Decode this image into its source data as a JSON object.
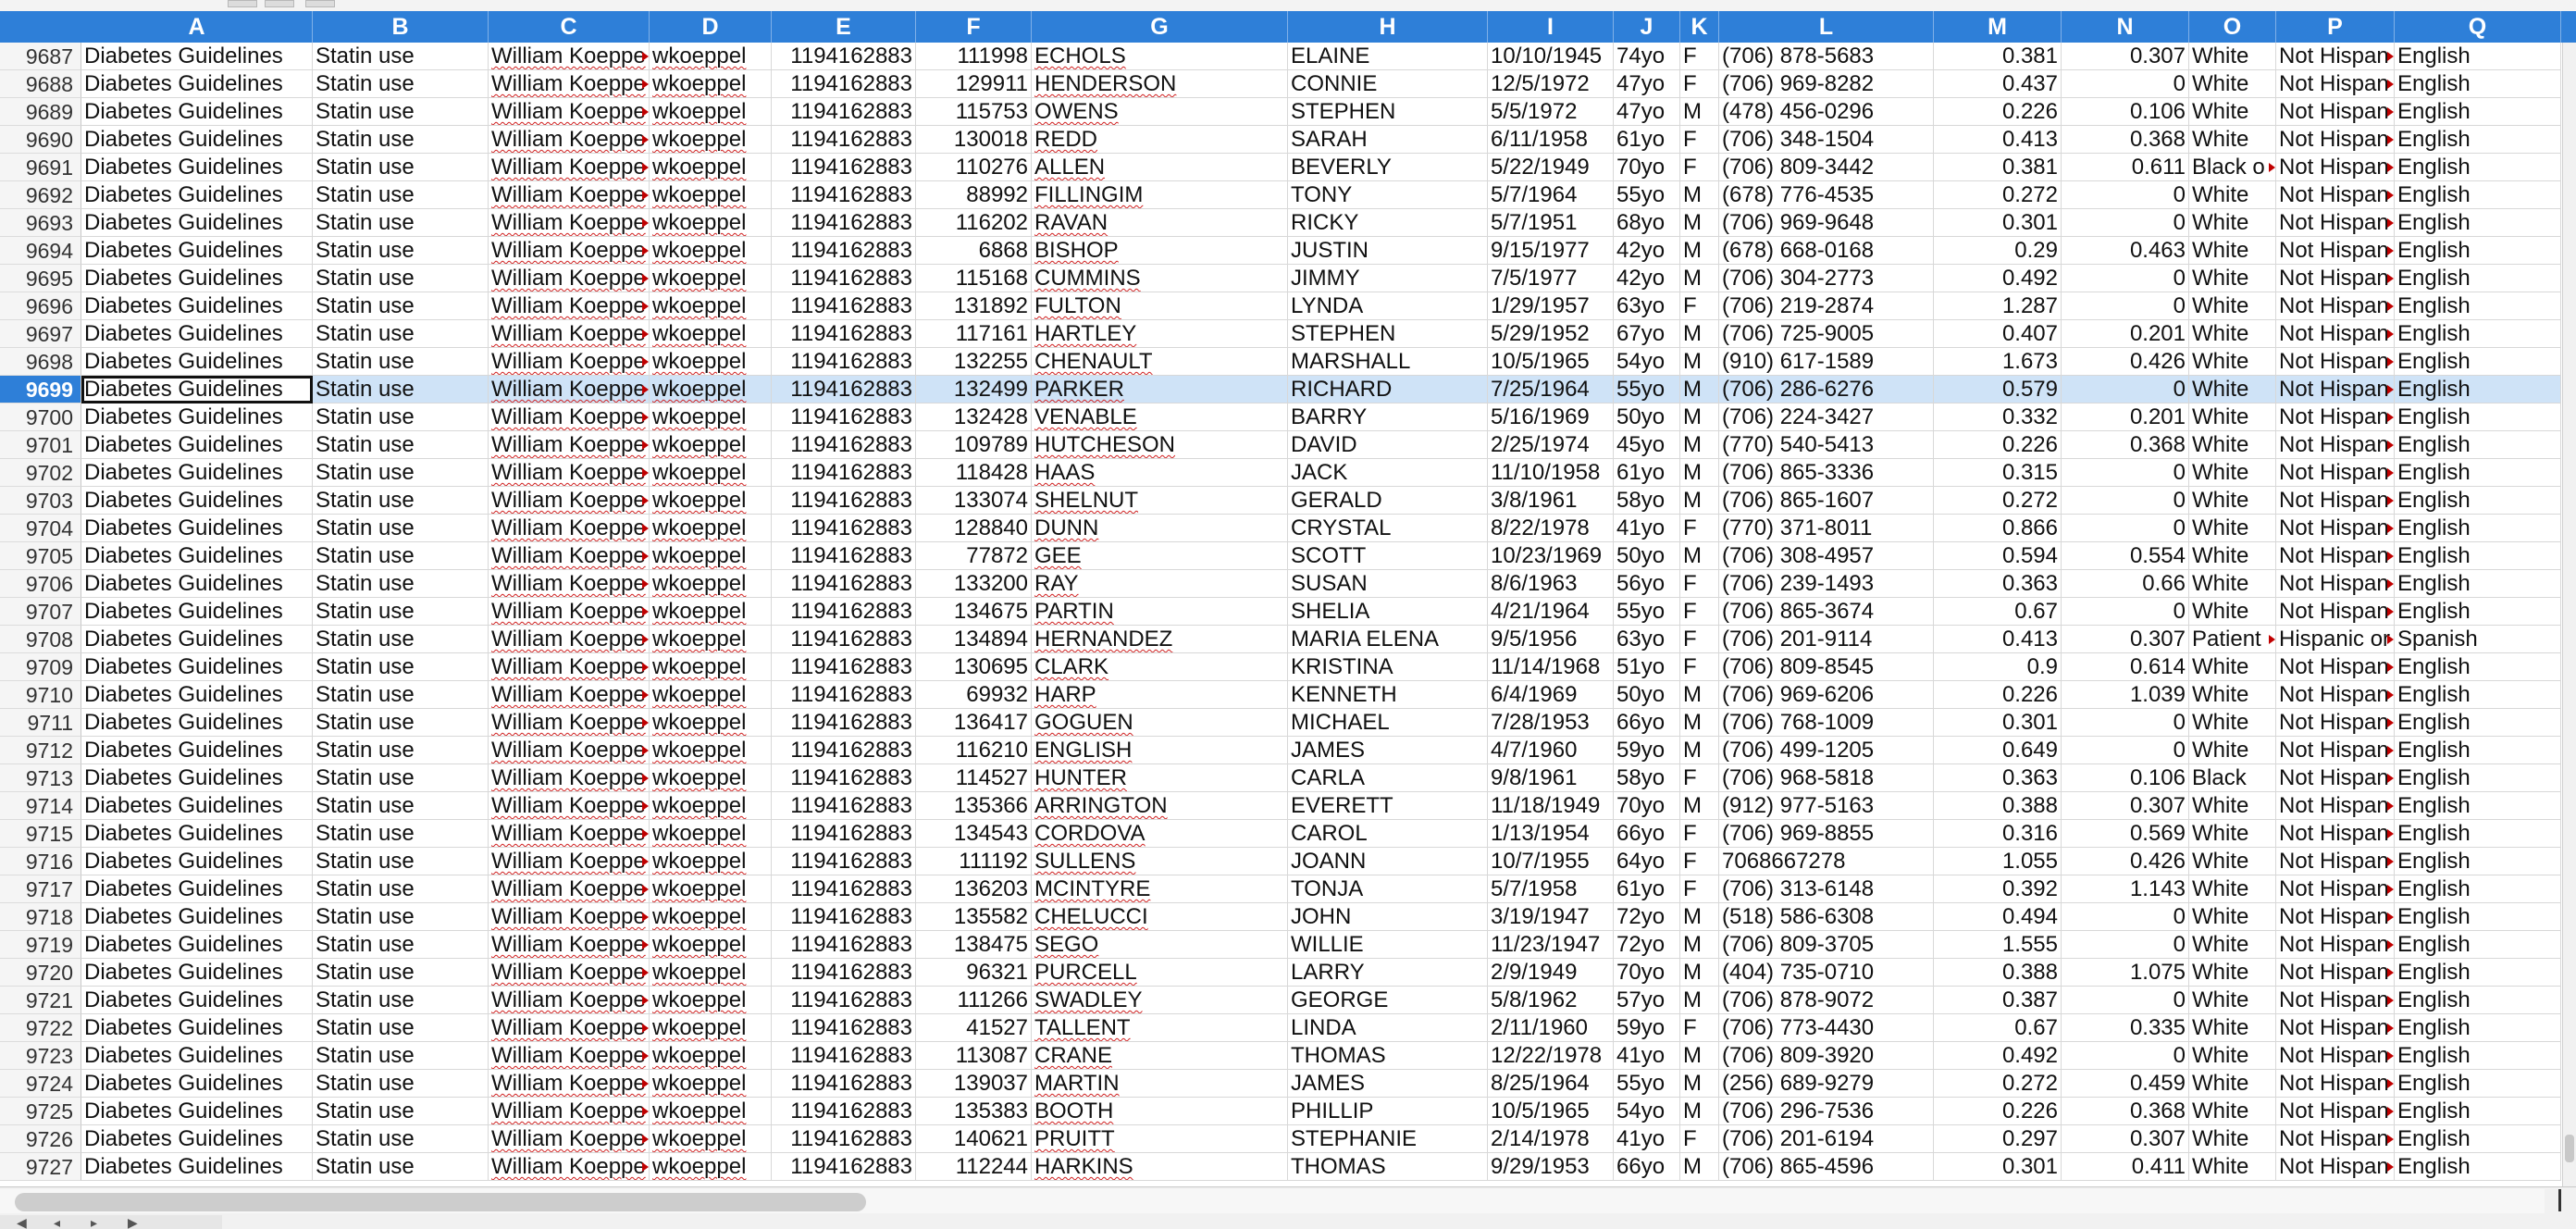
{
  "columns": [
    "A",
    "B",
    "C",
    "D",
    "E",
    "F",
    "G",
    "H",
    "I",
    "J",
    "K",
    "L",
    "M",
    "N",
    "O",
    "P",
    "Q"
  ],
  "selected_row": "9699",
  "rows": [
    [
      "9687",
      "Diabetes Guidelines",
      "Statin use",
      "William Koeppe",
      "wkoeppel",
      "1194162883",
      "111998",
      "ECHOLS",
      "ELAINE",
      "10/10/1945",
      "74yo",
      "F",
      "(706) 878-5683",
      "0.381",
      "0.307",
      "White",
      "Not Hispan",
      "English"
    ],
    [
      "9688",
      "Diabetes Guidelines",
      "Statin use",
      "William Koeppe",
      "wkoeppel",
      "1194162883",
      "129911",
      "HENDERSON",
      "CONNIE",
      "12/5/1972",
      "47yo",
      "F",
      "(706) 969-8282",
      "0.437",
      "0",
      "White",
      "Not Hispan",
      "English"
    ],
    [
      "9689",
      "Diabetes Guidelines",
      "Statin use",
      "William Koeppe",
      "wkoeppel",
      "1194162883",
      "115753",
      "OWENS",
      "STEPHEN",
      "5/5/1972",
      "47yo",
      "M",
      "(478) 456-0296",
      "0.226",
      "0.106",
      "White",
      "Not Hispan",
      "English"
    ],
    [
      "9690",
      "Diabetes Guidelines",
      "Statin use",
      "William Koeppe",
      "wkoeppel",
      "1194162883",
      "130018",
      "REDD",
      "SARAH",
      "6/11/1958",
      "61yo",
      "F",
      "(706) 348-1504",
      "0.413",
      "0.368",
      "White",
      "Not Hispan",
      "English"
    ],
    [
      "9691",
      "Diabetes Guidelines",
      "Statin use",
      "William Koeppe",
      "wkoeppel",
      "1194162883",
      "110276",
      "ALLEN",
      "BEVERLY",
      "5/22/1949",
      "70yo",
      "F",
      "(706) 809-3442",
      "0.381",
      "0.611",
      "Black o",
      "Not Hispan",
      "English"
    ],
    [
      "9692",
      "Diabetes Guidelines",
      "Statin use",
      "William Koeppe",
      "wkoeppel",
      "1194162883",
      "88992",
      "FILLINGIM",
      "TONY",
      "5/7/1964",
      "55yo",
      "M",
      "(678) 776-4535",
      "0.272",
      "0",
      "White",
      "Not Hispan",
      "English"
    ],
    [
      "9693",
      "Diabetes Guidelines",
      "Statin use",
      "William Koeppe",
      "wkoeppel",
      "1194162883",
      "116202",
      "RAVAN",
      "RICKY",
      "5/7/1951",
      "68yo",
      "M",
      "(706) 969-9648",
      "0.301",
      "0",
      "White",
      "Not Hispan",
      "English"
    ],
    [
      "9694",
      "Diabetes Guidelines",
      "Statin use",
      "William Koeppe",
      "wkoeppel",
      "1194162883",
      "6868",
      "BISHOP",
      "JUSTIN",
      "9/15/1977",
      "42yo",
      "M",
      "(678) 668-0168",
      "0.29",
      "0.463",
      "White",
      "Not Hispan",
      "English"
    ],
    [
      "9695",
      "Diabetes Guidelines",
      "Statin use",
      "William Koeppe",
      "wkoeppel",
      "1194162883",
      "115168",
      "CUMMINS",
      "JIMMY",
      "7/5/1977",
      "42yo",
      "M",
      "(706) 304-2773",
      "0.492",
      "0",
      "White",
      "Not Hispan",
      "English"
    ],
    [
      "9696",
      "Diabetes Guidelines",
      "Statin use",
      "William Koeppe",
      "wkoeppel",
      "1194162883",
      "131892",
      "FULTON",
      "LYNDA",
      "1/29/1957",
      "63yo",
      "F",
      "(706) 219-2874",
      "1.287",
      "0",
      "White",
      "Not Hispan",
      "English"
    ],
    [
      "9697",
      "Diabetes Guidelines",
      "Statin use",
      "William Koeppe",
      "wkoeppel",
      "1194162883",
      "117161",
      "HARTLEY",
      "STEPHEN",
      "5/29/1952",
      "67yo",
      "M",
      "(706) 725-9005",
      "0.407",
      "0.201",
      "White",
      "Not Hispan",
      "English"
    ],
    [
      "9698",
      "Diabetes Guidelines",
      "Statin use",
      "William Koeppe",
      "wkoeppel",
      "1194162883",
      "132255",
      "CHENAULT",
      "MARSHALL",
      "10/5/1965",
      "54yo",
      "M",
      "(910) 617-1589",
      "1.673",
      "0.426",
      "White",
      "Not Hispan",
      "English"
    ],
    [
      "9699",
      "Diabetes Guidelines",
      "Statin use",
      "William Koeppe",
      "wkoeppel",
      "1194162883",
      "132499",
      "PARKER",
      "RICHARD",
      "7/25/1964",
      "55yo",
      "M",
      "(706) 286-6276",
      "0.579",
      "0",
      "White",
      "Not Hispan",
      "English"
    ],
    [
      "9700",
      "Diabetes Guidelines",
      "Statin use",
      "William Koeppe",
      "wkoeppel",
      "1194162883",
      "132428",
      "VENABLE",
      "BARRY",
      "5/16/1969",
      "50yo",
      "M",
      "(706) 224-3427",
      "0.332",
      "0.201",
      "White",
      "Not Hispan",
      "English"
    ],
    [
      "9701",
      "Diabetes Guidelines",
      "Statin use",
      "William Koeppe",
      "wkoeppel",
      "1194162883",
      "109789",
      "HUTCHESON",
      "DAVID",
      "2/25/1974",
      "45yo",
      "M",
      "(770) 540-5413",
      "0.226",
      "0.368",
      "White",
      "Not Hispan",
      "English"
    ],
    [
      "9702",
      "Diabetes Guidelines",
      "Statin use",
      "William Koeppe",
      "wkoeppel",
      "1194162883",
      "118428",
      "HAAS",
      "JACK",
      "11/10/1958",
      "61yo",
      "M",
      "(706) 865-3336",
      "0.315",
      "0",
      "White",
      "Not Hispan",
      "English"
    ],
    [
      "9703",
      "Diabetes Guidelines",
      "Statin use",
      "William Koeppe",
      "wkoeppel",
      "1194162883",
      "133074",
      "SHELNUT",
      "GERALD",
      "3/8/1961",
      "58yo",
      "M",
      "(706) 865-1607",
      "0.272",
      "0",
      "White",
      "Not Hispan",
      "English"
    ],
    [
      "9704",
      "Diabetes Guidelines",
      "Statin use",
      "William Koeppe",
      "wkoeppel",
      "1194162883",
      "128840",
      "DUNN",
      "CRYSTAL",
      "8/22/1978",
      "41yo",
      "F",
      "(770) 371-8011",
      "0.866",
      "0",
      "White",
      "Not Hispan",
      "English"
    ],
    [
      "9705",
      "Diabetes Guidelines",
      "Statin use",
      "William Koeppe",
      "wkoeppel",
      "1194162883",
      "77872",
      "GEE",
      "SCOTT",
      "10/23/1969",
      "50yo",
      "M",
      "(706) 308-4957",
      "0.594",
      "0.554",
      "White",
      "Not Hispan",
      "English"
    ],
    [
      "9706",
      "Diabetes Guidelines",
      "Statin use",
      "William Koeppe",
      "wkoeppel",
      "1194162883",
      "133200",
      "RAY",
      "SUSAN",
      "8/6/1963",
      "56yo",
      "F",
      "(706) 239-1493",
      "0.363",
      "0.66",
      "White",
      "Not Hispan",
      "English"
    ],
    [
      "9707",
      "Diabetes Guidelines",
      "Statin use",
      "William Koeppe",
      "wkoeppel",
      "1194162883",
      "134675",
      "PARTIN",
      "SHELIA",
      "4/21/1964",
      "55yo",
      "F",
      "(706) 865-3674",
      "0.67",
      "0",
      "White",
      "Not Hispan",
      "English"
    ],
    [
      "9708",
      "Diabetes Guidelines",
      "Statin use",
      "William Koeppe",
      "wkoeppel",
      "1194162883",
      "134894",
      "HERNANDEZ",
      "MARIA ELENA",
      "9/5/1956",
      "63yo",
      "F",
      "(706) 201-9114",
      "0.413",
      "0.307",
      "Patient",
      "Hispanic or",
      "Spanish"
    ],
    [
      "9709",
      "Diabetes Guidelines",
      "Statin use",
      "William Koeppe",
      "wkoeppel",
      "1194162883",
      "130695",
      "CLARK",
      "KRISTINA",
      "11/14/1968",
      "51yo",
      "F",
      "(706) 809-8545",
      "0.9",
      "0.614",
      "White",
      "Not Hispan",
      "English"
    ],
    [
      "9710",
      "Diabetes Guidelines",
      "Statin use",
      "William Koeppe",
      "wkoeppel",
      "1194162883",
      "69932",
      "HARP",
      "KENNETH",
      "6/4/1969",
      "50yo",
      "M",
      "(706) 969-6206",
      "0.226",
      "1.039",
      "White",
      "Not Hispan",
      "English"
    ],
    [
      "9711",
      "Diabetes Guidelines",
      "Statin use",
      "William Koeppe",
      "wkoeppel",
      "1194162883",
      "136417",
      "GOGUEN",
      "MICHAEL",
      "7/28/1953",
      "66yo",
      "M",
      "(706) 768-1009",
      "0.301",
      "0",
      "White",
      "Not Hispan",
      "English"
    ],
    [
      "9712",
      "Diabetes Guidelines",
      "Statin use",
      "William Koeppe",
      "wkoeppel",
      "1194162883",
      "116210",
      "ENGLISH",
      "JAMES",
      "4/7/1960",
      "59yo",
      "M",
      "(706) 499-1205",
      "0.649",
      "0",
      "White",
      "Not Hispan",
      "English"
    ],
    [
      "9713",
      "Diabetes Guidelines",
      "Statin use",
      "William Koeppe",
      "wkoeppel",
      "1194162883",
      "114527",
      "HUNTER",
      "CARLA",
      "9/8/1961",
      "58yo",
      "F",
      "(706) 968-5818",
      "0.363",
      "0.106",
      "Black",
      "Not Hispan",
      "English"
    ],
    [
      "9714",
      "Diabetes Guidelines",
      "Statin use",
      "William Koeppe",
      "wkoeppel",
      "1194162883",
      "135366",
      "ARRINGTON",
      "EVERETT",
      "11/18/1949",
      "70yo",
      "M",
      "(912) 977-5163",
      "0.388",
      "0.307",
      "White",
      "Not Hispan",
      "English"
    ],
    [
      "9715",
      "Diabetes Guidelines",
      "Statin use",
      "William Koeppe",
      "wkoeppel",
      "1194162883",
      "134543",
      "CORDOVA",
      "CAROL",
      "1/13/1954",
      "66yo",
      "F",
      "(706) 969-8855",
      "0.316",
      "0.569",
      "White",
      "Not Hispan",
      "English"
    ],
    [
      "9716",
      "Diabetes Guidelines",
      "Statin use",
      "William Koeppe",
      "wkoeppel",
      "1194162883",
      "111192",
      "SULLENS",
      "JOANN",
      "10/7/1955",
      "64yo",
      "F",
      "7068667278",
      "1.055",
      "0.426",
      "White",
      "Not Hispan",
      "English"
    ],
    [
      "9717",
      "Diabetes Guidelines",
      "Statin use",
      "William Koeppe",
      "wkoeppel",
      "1194162883",
      "136203",
      "MCINTYRE",
      "TONJA",
      "5/7/1958",
      "61yo",
      "F",
      "(706) 313-6148",
      "0.392",
      "1.143",
      "White",
      "Not Hispan",
      "English"
    ],
    [
      "9718",
      "Diabetes Guidelines",
      "Statin use",
      "William Koeppe",
      "wkoeppel",
      "1194162883",
      "135582",
      "CHELUCCI",
      "JOHN",
      "3/19/1947",
      "72yo",
      "M",
      "(518) 586-6308",
      "0.494",
      "0",
      "White",
      "Not Hispan",
      "English"
    ],
    [
      "9719",
      "Diabetes Guidelines",
      "Statin use",
      "William Koeppe",
      "wkoeppel",
      "1194162883",
      "138475",
      "SEGO",
      "WILLIE",
      "11/23/1947",
      "72yo",
      "M",
      "(706) 809-3705",
      "1.555",
      "0",
      "White",
      "Not Hispan",
      "English"
    ],
    [
      "9720",
      "Diabetes Guidelines",
      "Statin use",
      "William Koeppe",
      "wkoeppel",
      "1194162883",
      "96321",
      "PURCELL",
      "LARRY",
      "2/9/1949",
      "70yo",
      "M",
      "(404) 735-0710",
      "0.388",
      "1.075",
      "White",
      "Not Hispan",
      "English"
    ],
    [
      "9721",
      "Diabetes Guidelines",
      "Statin use",
      "William Koeppe",
      "wkoeppel",
      "1194162883",
      "111266",
      "SWADLEY",
      "GEORGE",
      "5/8/1962",
      "57yo",
      "M",
      "(706) 878-9072",
      "0.387",
      "0",
      "White",
      "Not Hispan",
      "English"
    ],
    [
      "9722",
      "Diabetes Guidelines",
      "Statin use",
      "William Koeppe",
      "wkoeppel",
      "1194162883",
      "41527",
      "TALLENT",
      "LINDA",
      "2/11/1960",
      "59yo",
      "F",
      "(706) 773-4430",
      "0.67",
      "0.335",
      "White",
      "Not Hispan",
      "English"
    ],
    [
      "9723",
      "Diabetes Guidelines",
      "Statin use",
      "William Koeppe",
      "wkoeppel",
      "1194162883",
      "113087",
      "CRANE",
      "THOMAS",
      "12/22/1978",
      "41yo",
      "M",
      "(706) 809-3920",
      "0.492",
      "0",
      "White",
      "Not Hispan",
      "English"
    ],
    [
      "9724",
      "Diabetes Guidelines",
      "Statin use",
      "William Koeppe",
      "wkoeppel",
      "1194162883",
      "139037",
      "MARTIN",
      "JAMES",
      "8/25/1964",
      "55yo",
      "M",
      "(256) 689-9279",
      "0.272",
      "0.459",
      "White",
      "Not Hispan",
      "English"
    ],
    [
      "9725",
      "Diabetes Guidelines",
      "Statin use",
      "William Koeppe",
      "wkoeppel",
      "1194162883",
      "135383",
      "BOOTH",
      "PHILLIP",
      "10/5/1965",
      "54yo",
      "M",
      "(706) 296-7536",
      "0.226",
      "0.368",
      "White",
      "Not Hispan",
      "English"
    ],
    [
      "9726",
      "Diabetes Guidelines",
      "Statin use",
      "William Koeppe",
      "wkoeppel",
      "1194162883",
      "140621",
      "PRUITT",
      "STEPHANIE",
      "2/14/1978",
      "41yo",
      "F",
      "(706) 201-6194",
      "0.297",
      "0.307",
      "White",
      "Not Hispan",
      "English"
    ],
    [
      "9727",
      "Diabetes Guidelines",
      "Statin use",
      "William Koeppe",
      "wkoeppel",
      "1194162883",
      "112244",
      "HARKINS",
      "THOMAS",
      "9/29/1953",
      "66yo",
      "M",
      "(706) 865-4596",
      "0.301",
      "0.411",
      "White",
      "Not Hispan",
      "English"
    ]
  ]
}
